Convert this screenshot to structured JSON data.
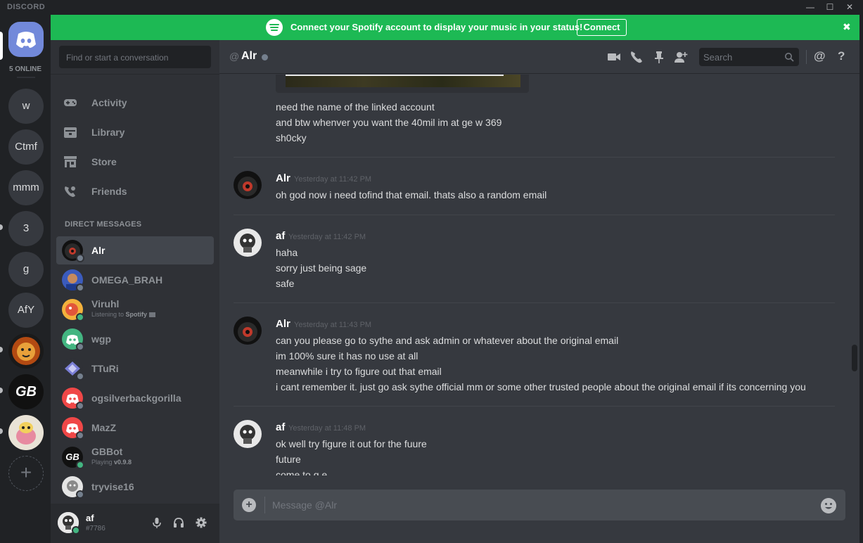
{
  "titlebar": {
    "brand": "DISCORD",
    "minimize": "—",
    "maximize": "☐",
    "close": "✕"
  },
  "banner": {
    "text": "Connect your Spotify account to display your music in your status!",
    "button": "Connect",
    "close": "✖"
  },
  "guilds": {
    "online_count": "5 ONLINE",
    "items": [
      {
        "label": "w"
      },
      {
        "label": "Ctmf"
      },
      {
        "label": "mmm"
      },
      {
        "label": "3"
      },
      {
        "label": "g"
      },
      {
        "label": "AfY"
      },
      {
        "label": ""
      },
      {
        "label": "GB"
      },
      {
        "label": ""
      }
    ],
    "add_label": "+"
  },
  "sidebar": {
    "find_placeholder": "Find or start a conversation",
    "nav": [
      {
        "label": "Activity",
        "icon": "controller-icon"
      },
      {
        "label": "Library",
        "icon": "library-icon"
      },
      {
        "label": "Store",
        "icon": "store-icon"
      },
      {
        "label": "Friends",
        "icon": "friends-icon"
      }
    ],
    "dm_header": "DIRECT MESSAGES",
    "dms": [
      {
        "name": "Alr"
      },
      {
        "name": "OMEGA_BRAH"
      },
      {
        "name": "Viruhl",
        "sub_prefix": "Listening to ",
        "sub_bold": "Spotify"
      },
      {
        "name": "wgp"
      },
      {
        "name": "TTuRi"
      },
      {
        "name": "ogsilverbackgorilla"
      },
      {
        "name": "MazZ"
      },
      {
        "name": "GBBot",
        "sub_prefix": "Playing ",
        "sub_bold": "v0.9.8"
      },
      {
        "name": "tryvise16"
      }
    ]
  },
  "user": {
    "name": "af",
    "tag": "#7786"
  },
  "chat": {
    "at": "@",
    "channel": "Alr",
    "search_placeholder": "Search",
    "mention_icon": "@",
    "help_icon": "?",
    "top_lines": [
      "need the name of the linked account",
      "and btw whenver you want the 40mil im at ge w 369",
      "sh0cky"
    ],
    "messages": [
      {
        "author": "Alr",
        "time": "Yesterday at 11:42 PM",
        "lines": [
          "oh god now i need tofind that email. thats also a random email"
        ]
      },
      {
        "author": "af",
        "time": "Yesterday at 11:42 PM",
        "lines": [
          "haha",
          "sorry just being sage",
          "safe"
        ]
      },
      {
        "author": "Alr",
        "time": "Yesterday at 11:43 PM",
        "lines": [
          "can you please go to sythe and ask admin or whatever about the original email",
          "im 100% sure it has no use at all",
          "meanwhile i try to figure out that email",
          "i cant remember it. just go ask sythe official mm or some other trusted people about the original email if its concerning you"
        ]
      },
      {
        "author": "af",
        "time": "Yesterday at 11:48 PM",
        "lines": [
          "ok well try figure it out for the fuure",
          "future",
          "come to g.e"
        ]
      }
    ],
    "composer_placeholder": "Message @Alr"
  }
}
